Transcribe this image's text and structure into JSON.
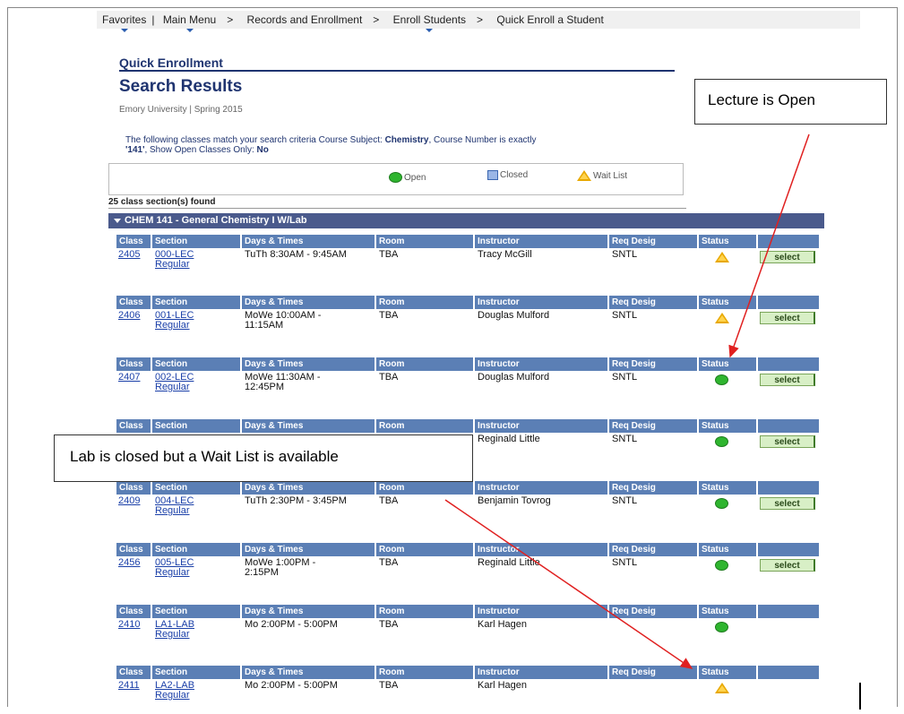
{
  "breadcrumb": {
    "items": [
      "Favorites",
      "Main Menu",
      "Records and Enrollment",
      "Enroll Students",
      "Quick Enroll a Student"
    ],
    "separator": ">"
  },
  "page": {
    "heading": "Quick Enrollment",
    "title": "Search Results",
    "institution": "Emory University | Spring 2015",
    "criteria_prefix": "The following classes match your search criteria Course Subject:",
    "criteria_subject": "Chemistry",
    "criteria_mid": ",  Course Number is exactly",
    "criteria_number": "'141'",
    "criteria_open": ",  Show Open Classes Only:",
    "criteria_open_value": "No"
  },
  "legend": {
    "open": "Open",
    "closed": "Closed",
    "waitlist": "Wait List"
  },
  "results_count": "25 class section(s) found",
  "course_header": "CHEM 141 - General Chemistry I W/Lab",
  "columns": [
    "Class",
    "Section",
    "Days & Times",
    "Room",
    "Instructor",
    "Req Desig",
    "Status"
  ],
  "sections": [
    {
      "class": "2405",
      "section": "000-LEC",
      "session": "Regular",
      "days_times": "TuTh 8:30AM - 9:45AM",
      "room": "TBA",
      "instructor": "Tracy McGill",
      "req": "SNTL",
      "status": "waitlist",
      "select": "select"
    },
    {
      "class": "2406",
      "section": "001-LEC",
      "session": "Regular",
      "days_times": "MoWe 10:00AM -\n11:15AM",
      "room": "TBA",
      "instructor": "Douglas Mulford",
      "req": "SNTL",
      "status": "waitlist",
      "select": "select"
    },
    {
      "class": "2407",
      "section": "002-LEC",
      "session": "Regular",
      "days_times": "MoWe 11:30AM -\n12:45PM",
      "room": "TBA",
      "instructor": "Douglas Mulford",
      "req": "SNTL",
      "status": "open",
      "select": "select"
    },
    {
      "class": "",
      "section": "",
      "session": "",
      "days_times": "",
      "room": "",
      "instructor": "Reginald Little",
      "req": "SNTL",
      "status": "open",
      "select": "select"
    },
    {
      "class": "2409",
      "section": "004-LEC",
      "session": "Regular",
      "days_times": "TuTh 2:30PM - 3:45PM",
      "room": "TBA",
      "instructor": "Benjamin Tovrog",
      "req": "SNTL",
      "status": "open",
      "select": "select"
    },
    {
      "class": "2456",
      "section": "005-LEC",
      "session": "Regular",
      "days_times": "MoWe 1:00PM -\n2:15PM",
      "room": "TBA",
      "instructor": "Reginald Little",
      "req": "SNTL",
      "status": "open",
      "select": "select"
    },
    {
      "class": "2410",
      "section": "LA1-LAB",
      "session": "Regular",
      "days_times": "Mo 2:00PM - 5:00PM",
      "room": "TBA",
      "instructor": "Karl Hagen",
      "req": "",
      "status": "open",
      "select": ""
    },
    {
      "class": "2411",
      "section": "LA2-LAB",
      "session": "Regular",
      "days_times": "Mo 2:00PM - 5:00PM",
      "room": "TBA",
      "instructor": "Karl Hagen",
      "req": "",
      "status": "waitlist",
      "select": ""
    }
  ],
  "callouts": {
    "lecture": "Lecture is Open",
    "lab": "Lab is closed but a Wait List is available"
  },
  "colors": {
    "header_blue": "#5b7fb5",
    "course_bar": "#4a5a8c",
    "title_navy": "#1f3470",
    "open_green": "#2fb52f",
    "waitlist_yellow": "#e8a800",
    "arrow_red": "#e02020"
  }
}
